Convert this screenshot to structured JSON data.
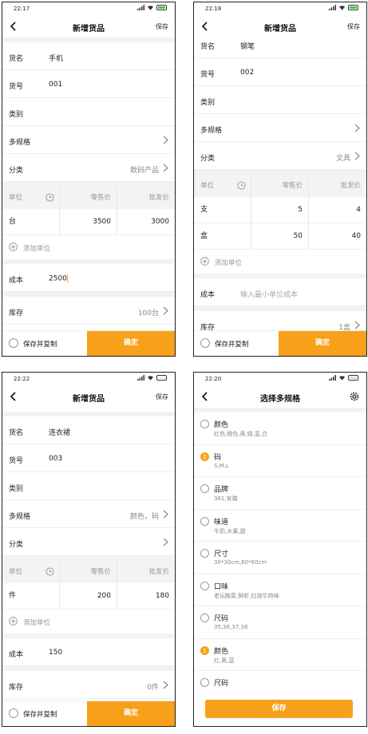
{
  "labels": {
    "name": "货名",
    "code": "货号",
    "category": "类别",
    "spec": "多规格",
    "class": "分类",
    "unit": "单位",
    "retail": "零售价",
    "wholesale": "批发价",
    "add_unit": "添加单位",
    "cost": "成本",
    "stock": "库存",
    "save_copy": "保存并复制",
    "confirm": "确定",
    "save": "保存",
    "cost_placeholder": "输入最小单位成本"
  },
  "screen1": {
    "time": "22:17",
    "title": "新增货品",
    "name": "手机",
    "code": "001",
    "class_value": "数码产品",
    "rows": [
      {
        "unit": "台",
        "retail": "3500",
        "wholesale": "3000"
      }
    ],
    "cost": "2500",
    "stock": "100台"
  },
  "screen2": {
    "time": "22:18",
    "title": "新增货品",
    "name": "钢笔",
    "code": "002",
    "class_value": "文具",
    "rows": [
      {
        "unit": "支",
        "retail": "5",
        "wholesale": "4"
      },
      {
        "unit": "盒",
        "retail": "50",
        "wholesale": "40"
      }
    ],
    "stock": "1盒"
  },
  "screen3": {
    "time": "22:22",
    "title": "新增货品",
    "name": "连衣裙",
    "code": "003",
    "spec_value": "颜色，码",
    "rows": [
      {
        "unit": "件",
        "retail": "200",
        "wholesale": "180"
      }
    ],
    "cost": "150",
    "stock": "0件"
  },
  "screen4": {
    "time": "22:20",
    "title": "选择多规格",
    "save": "保存",
    "options": [
      {
        "name": "颜色",
        "values": "红色,橙色,黄,绿,蓝,白",
        "badge": ""
      },
      {
        "name": "码",
        "values": "S,M,L",
        "badge": "2"
      },
      {
        "name": "品牌",
        "values": "361,安踏",
        "badge": ""
      },
      {
        "name": "味道",
        "values": "牛奶,水果,甜",
        "badge": ""
      },
      {
        "name": "尺寸",
        "values": "30*30cm,60*60cm",
        "badge": ""
      },
      {
        "name": "口味",
        "values": "老坛酸菜,鲜虾,红烧牛肉味",
        "badge": ""
      },
      {
        "name": "尺码",
        "values": "35,36,37,38",
        "badge": ""
      },
      {
        "name": "颜色",
        "values": "红,黄,蓝",
        "badge": "1"
      },
      {
        "name": "尺码",
        "values": "",
        "badge": ""
      }
    ]
  },
  "colors": {
    "accent": "#f9a01b",
    "battery": "#33cc33"
  }
}
